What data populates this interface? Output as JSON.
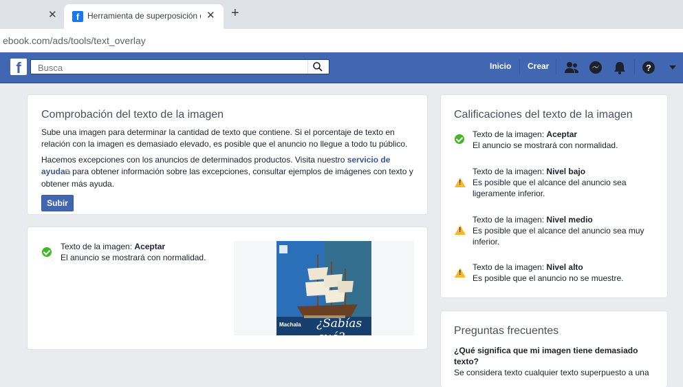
{
  "browser": {
    "tab_title": "Herramienta de superposición de",
    "url": "ebook.com/ads/tools/text_overlay"
  },
  "fb": {
    "search_placeholder": "Busca",
    "nav": [
      "Inicio",
      "Crear"
    ]
  },
  "check_card": {
    "title": "Comprobación del texto de la imagen",
    "p1": "Sube una imagen para determinar la cantidad de texto que contiene. Si el porcentaje de texto en relación con la imagen es demasiado elevado, es posible que el anuncio no llegue a todo tu público.",
    "p2_start": "Hacemos excepciones con los anuncios de determinados productos. Visita nuestro ",
    "p2_link": "servicio de ayuda",
    "p2_end": " para obtener información sobre las excepciones, consultar ejemplos de imágenes con texto y obtener más ayuda.",
    "button": "Subir"
  },
  "result_card": {
    "label": "Texto de la imagen: ",
    "value": "Aceptar",
    "desc": "El anuncio se mostrará con normalidad.",
    "image_text": "¿Sabías qué?",
    "image_brand": "Machala"
  },
  "ratings": {
    "title": "Calificaciones del texto de la imagen",
    "items": [
      {
        "label": "Texto de la imagen: ",
        "value": "Aceptar",
        "desc": "El anuncio se mostrará con normalidad.",
        "icon": "check-icon"
      },
      {
        "label": "Texto de la imagen: ",
        "value": "Nivel bajo",
        "desc": "Es posible que el alcance del anuncio sea ligeramente inferior.",
        "icon": "warning-icon"
      },
      {
        "label": "Texto de la imagen: ",
        "value": "Nivel medio",
        "desc": "Es posible que el alcance del anuncio sea muy inferior.",
        "icon": "warning-icon"
      },
      {
        "label": "Texto de la imagen: ",
        "value": "Nivel alto",
        "desc": "Es posible que el anuncio no se muestre.",
        "icon": "warning-icon"
      }
    ]
  },
  "faq": {
    "title": "Preguntas frecuentes",
    "question": "¿Qué significa que mi imagen tiene demasiado texto?",
    "answer": "Se considera texto cualquier texto superpuesto a una"
  },
  "colors": {
    "fb_blue": "#4267b2",
    "ok_green": "#42b72a",
    "warn_yellow": "#f7b928"
  }
}
